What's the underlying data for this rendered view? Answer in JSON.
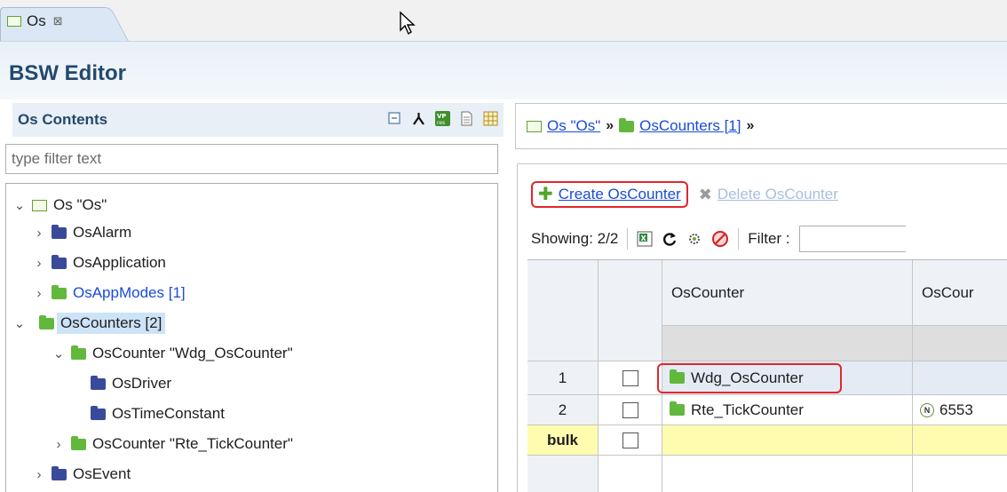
{
  "tab": {
    "label": "Os",
    "close_glyph": "⊠"
  },
  "editor": {
    "title": "BSW Editor"
  },
  "left_panel": {
    "title": "Os Contents",
    "filter_placeholder": "type filter text",
    "tools": [
      "collapse-all-icon",
      "hierarchy-icon",
      "vp-res-icon",
      "document-icon",
      "table-expand-icon"
    ],
    "tree": {
      "root": "Os \"Os\"",
      "os_alarm": "OsAlarm",
      "os_application": "OsApplication",
      "os_app_modes": "OsAppModes [1]",
      "os_counters": "OsCounters [2]",
      "counter_wdg": "OsCounter \"Wdg_OsCounter\"",
      "os_driver": "OsDriver",
      "os_time_constant": "OsTimeConstant",
      "counter_rte": "OsCounter \"Rte_TickCounter\"",
      "os_event": "OsEvent"
    }
  },
  "breadcrumb": {
    "root": "Os \"Os\"",
    "counters": "OsCounters [1]",
    "sep": "»"
  },
  "actions": {
    "create": "Create OsCounter",
    "delete": "Delete OsCounter"
  },
  "toolbar": {
    "showing": "Showing: 2/2",
    "filter_label": "Filter :"
  },
  "table": {
    "columns": [
      "OsCounter",
      "OsCour"
    ],
    "rows": [
      {
        "num": "1",
        "name": "Wdg_OsCounter",
        "value": ""
      },
      {
        "num": "2",
        "name": "Rte_TickCounter",
        "value": "6553"
      }
    ],
    "bulk_label": "bulk",
    "badge": "N"
  },
  "colors": {
    "accent_red": "#e2262b",
    "link_blue": "#1a4cd6",
    "folder_green": "#62b83c",
    "folder_navy": "#3a4a9a",
    "bulk_yellow": "#fffcb0"
  }
}
